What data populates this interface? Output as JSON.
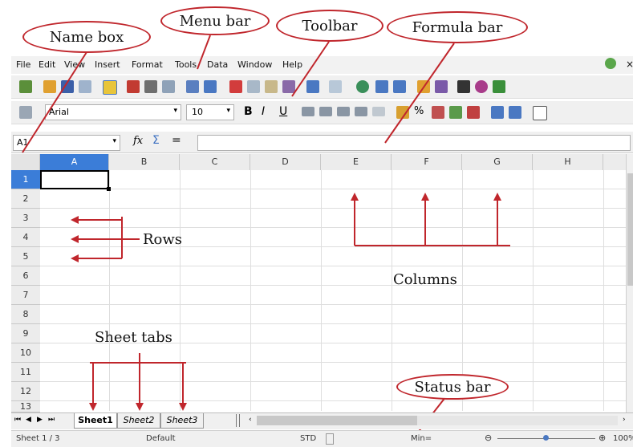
{
  "callouts": {
    "name_box": "Name box",
    "menu_bar": "Menu bar",
    "toolbar": "Toolbar",
    "formula_bar": "Formula bar",
    "status_bar": "Status bar"
  },
  "labels": {
    "rows": "Rows",
    "columns": "Columns",
    "sheet_tabs": "Sheet tabs"
  },
  "menu": [
    "File",
    "Edit",
    "View",
    "Insert",
    "Format",
    "Tools",
    "Data",
    "Window",
    "Help"
  ],
  "formatting": {
    "font_name": "Arial",
    "font_size": "10"
  },
  "name_box_value": "A1",
  "formula_symbols": {
    "fx": "fx",
    "sum": "Σ",
    "equals": "="
  },
  "columns": [
    "A",
    "B",
    "C",
    "D",
    "E",
    "F",
    "G",
    "H"
  ],
  "rows": [
    "1",
    "2",
    "3",
    "4",
    "5",
    "6",
    "7",
    "8",
    "9",
    "10",
    "11",
    "12",
    "13"
  ],
  "sheet_tabs": [
    "Sheet1",
    "Sheet2",
    "Sheet3"
  ],
  "status": {
    "sheet": "Sheet 1 / 3",
    "style": "Default",
    "mode": "STD",
    "sum": "Min=",
    "zoom": "100%"
  },
  "colors": {
    "annotation": "#c0262c",
    "selected_header": "#3b7dd8"
  }
}
